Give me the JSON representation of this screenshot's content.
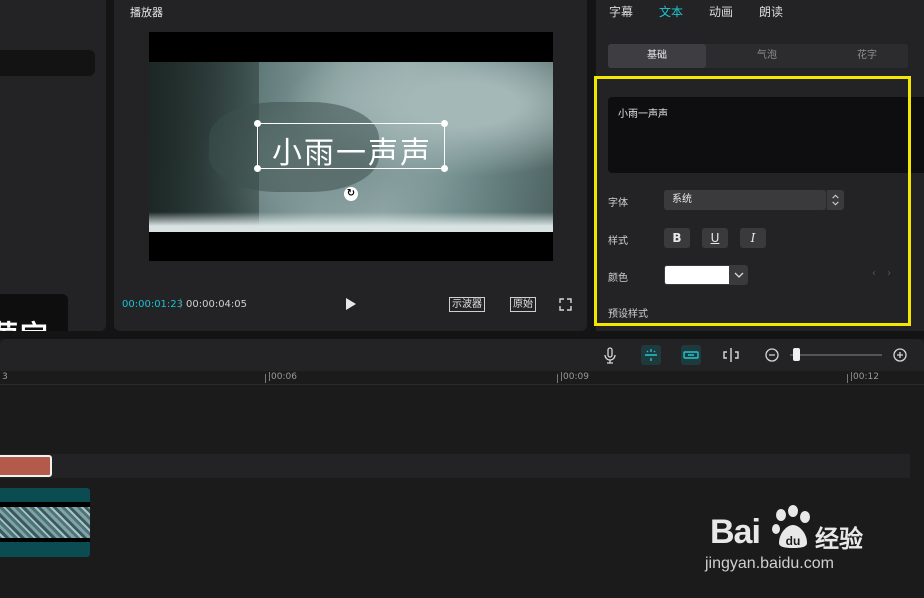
{
  "player": {
    "title": "播放器",
    "caption_text": "小雨一声声",
    "time_current": "00:00:01:23",
    "time_separator": "|",
    "time_total": "00:00:04:05",
    "scope_label": "示波器",
    "original_label": "原始"
  },
  "left_panel": {
    "preview_text": "萤宝"
  },
  "inspector": {
    "tabs": [
      {
        "label": "字幕",
        "active": false
      },
      {
        "label": "文本",
        "active": true
      },
      {
        "label": "动画",
        "active": false
      },
      {
        "label": "朗读",
        "active": false
      }
    ],
    "segments": [
      {
        "label": "基础",
        "active": true
      },
      {
        "label": "气泡",
        "active": false
      },
      {
        "label": "花字",
        "active": false
      }
    ],
    "text_value": "小雨一声声",
    "font_label": "字体",
    "font_value": "系统",
    "style_label": "样式",
    "style_buttons": [
      "B",
      "U",
      "I"
    ],
    "color_label": "颜色",
    "color_value": "#ffffff",
    "preset_label": "预设样式",
    "nav_arrows": "‹ ›"
  },
  "timeline": {
    "tick_labels": [
      "3",
      "|00:06",
      "|00:09",
      "|00:12"
    ]
  },
  "watermark": {
    "brand": "Bai",
    "brand_du": "du",
    "cn": "经验",
    "url": "jingyan.baidu.com"
  },
  "colors": {
    "accent": "#1fc7d2",
    "highlight": "#f3e600",
    "text_clip": "#b35a4b",
    "video_clip": "#0b4b52"
  }
}
